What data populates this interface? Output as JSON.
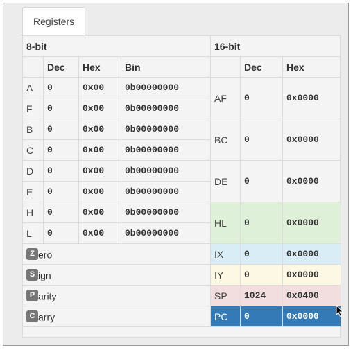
{
  "tabs": [
    {
      "label": "Registers"
    }
  ],
  "headers": {
    "group_8bit": "8-bit",
    "group_16bit": "16-bit",
    "cols8": [
      "Dec",
      "Hex",
      "Bin"
    ],
    "cols16": [
      "Dec",
      "Hex"
    ]
  },
  "regs8": [
    {
      "name": "A",
      "dec": "0",
      "hex": "0x00",
      "bin": "0b00000000"
    },
    {
      "name": "F",
      "dec": "0",
      "hex": "0x00",
      "bin": "0b00000000"
    },
    {
      "name": "B",
      "dec": "0",
      "hex": "0x00",
      "bin": "0b00000000"
    },
    {
      "name": "C",
      "dec": "0",
      "hex": "0x00",
      "bin": "0b00000000"
    },
    {
      "name": "D",
      "dec": "0",
      "hex": "0x00",
      "bin": "0b00000000"
    },
    {
      "name": "E",
      "dec": "0",
      "hex": "0x00",
      "bin": "0b00000000"
    },
    {
      "name": "H",
      "dec": "0",
      "hex": "0x00",
      "bin": "0b00000000"
    },
    {
      "name": "L",
      "dec": "0",
      "hex": "0x00",
      "bin": "0b00000000"
    }
  ],
  "regs16_pairs": [
    {
      "name": "AF",
      "dec": "0",
      "hex": "0x0000"
    },
    {
      "name": "BC",
      "dec": "0",
      "hex": "0x0000"
    },
    {
      "name": "DE",
      "dec": "0",
      "hex": "0x0000"
    },
    {
      "name": "HL",
      "dec": "0",
      "hex": "0x0000",
      "color": "#dff0d8"
    }
  ],
  "flags": [
    {
      "letter": "Z",
      "rest": "ero"
    },
    {
      "letter": "S",
      "rest": "ign"
    },
    {
      "letter": "P",
      "rest": "arity"
    },
    {
      "letter": "C",
      "rest": "arry"
    }
  ],
  "regs16_single": [
    {
      "name": "IX",
      "dec": "0",
      "hex": "0x0000",
      "color": "#d9edf7"
    },
    {
      "name": "IY",
      "dec": "0",
      "hex": "0x0000",
      "color": "#fcf8e3"
    },
    {
      "name": "SP",
      "dec": "1024",
      "hex": "0x0400",
      "color": "#f2dede"
    },
    {
      "name": "PC",
      "dec": "0",
      "hex": "0x0000",
      "color": "#337ab7"
    }
  ],
  "icons": {
    "cursor": "mouse-pointer-icon"
  }
}
